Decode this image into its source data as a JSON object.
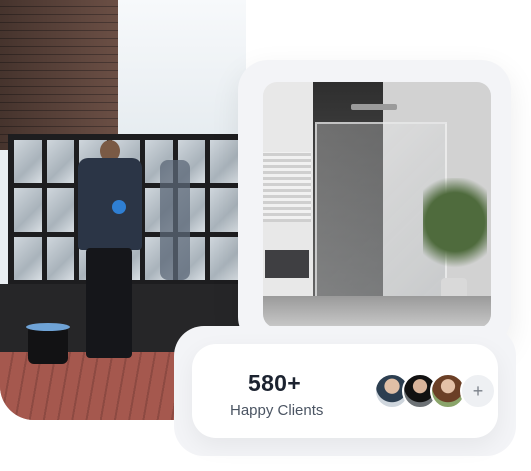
{
  "stats": {
    "clients_count": "580+",
    "clients_label": "Happy Clients",
    "plus_icon_text": "+"
  },
  "avatars": [
    {
      "icon": "client-avatar-1"
    },
    {
      "icon": "client-avatar-2"
    },
    {
      "icon": "client-avatar-3"
    }
  ]
}
